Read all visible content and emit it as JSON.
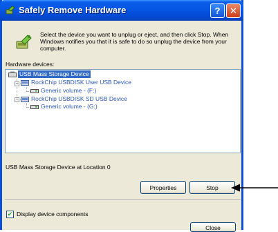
{
  "window": {
    "title": "Safely Remove Hardware",
    "help_glyph": "?",
    "close_glyph": "✕"
  },
  "instructions": "Select the device you want to unplug or eject, and then click Stop. When Windows notifies you that it is safe to do so unplug the device from your computer.",
  "hardware_label": "Hardware devices:",
  "tree": {
    "items": [
      {
        "label": "USB Mass Storage Device",
        "selected": true
      },
      {
        "label": "RockChip USBDISK  User USB Device"
      },
      {
        "label": "Generic volume - (F:)"
      },
      {
        "label": "RockChip USBDISK   SD USB Device"
      },
      {
        "label": "Generic volume - (G:)"
      }
    ]
  },
  "location_text": "USB Mass Storage Device at Location 0",
  "buttons": {
    "properties": "Properties",
    "stop": "Stop",
    "close": "Close"
  },
  "checkbox": {
    "label": "Display device components",
    "checked": true,
    "mark": "✔"
  },
  "colors": {
    "titlebar": "#0554e3",
    "selection": "#316ac5",
    "dialog_bg": "#ece9d8",
    "link_text": "#2a55b0"
  }
}
